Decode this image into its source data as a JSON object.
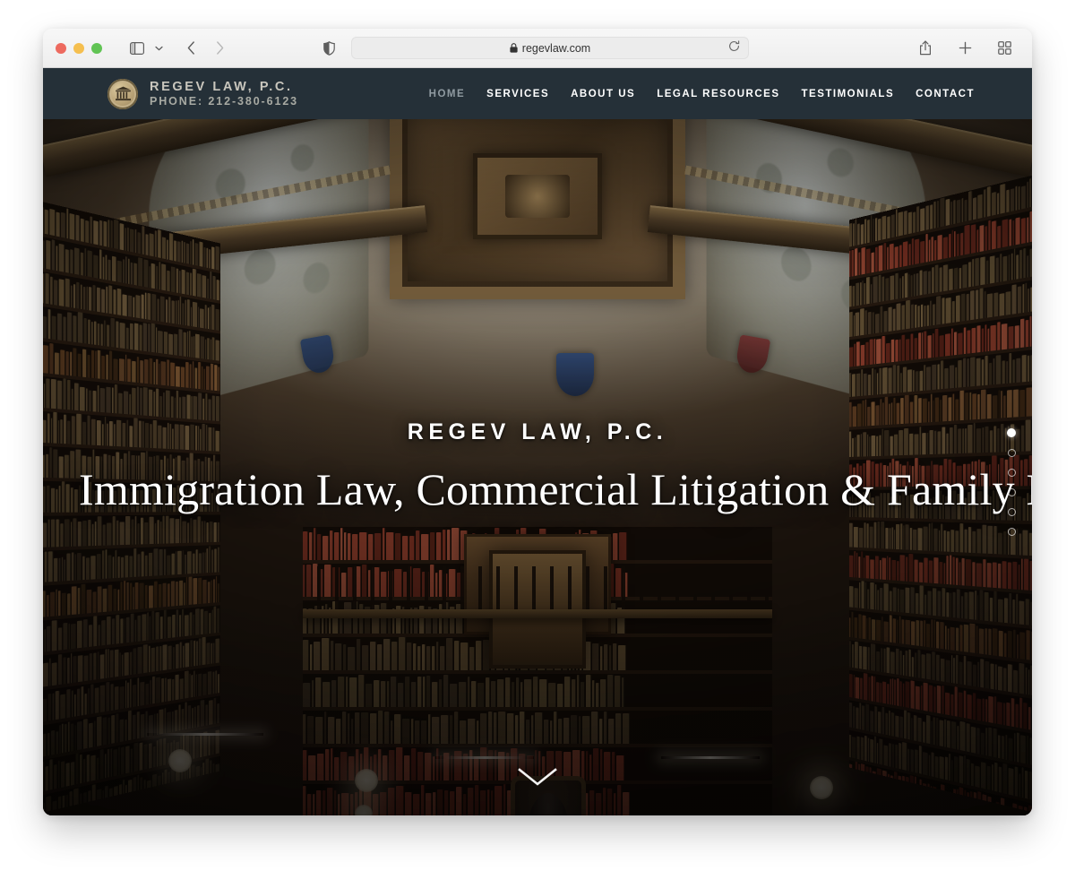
{
  "browser": {
    "traffic_lights": [
      "close",
      "minimize",
      "zoom"
    ],
    "sidebar_icon": "sidebar-icon",
    "chevron_icon": "chevron-down-icon",
    "back_icon": "back-arrow-icon",
    "forward_icon": "forward-arrow-icon",
    "shield_icon": "privacy-shield-icon",
    "lock_icon": "lock-icon",
    "url": "regevlaw.com",
    "reload_icon": "reload-icon",
    "share_icon": "share-icon",
    "new_tab_icon": "plus-icon",
    "tab_overview_icon": "tab-grid-icon"
  },
  "site": {
    "logo_icon": "courthouse-icon",
    "brand_name": "REGEV LAW, P.C.",
    "brand_phone": "PHONE: 212-380-6123",
    "nav": [
      {
        "label": "HOME",
        "active": true
      },
      {
        "label": "SERVICES",
        "active": false
      },
      {
        "label": "ABOUT US",
        "active": false
      },
      {
        "label": "LEGAL RESOURCES",
        "active": false
      },
      {
        "label": "TESTIMONIALS",
        "active": false
      },
      {
        "label": "CONTACT",
        "active": false
      }
    ],
    "hero": {
      "eyebrow": "REGEV LAW, P.C.",
      "title": "Immigration Law, Commercial Litigation & Family Law",
      "scroll_icon": "chevron-down-icon"
    },
    "slider": {
      "total": 6,
      "active_index": 0
    },
    "colors": {
      "header_bg": "#253038",
      "brand_gold": "#c4b189",
      "nav_text": "#ffffff",
      "nav_muted": "#8f9aa1"
    }
  }
}
